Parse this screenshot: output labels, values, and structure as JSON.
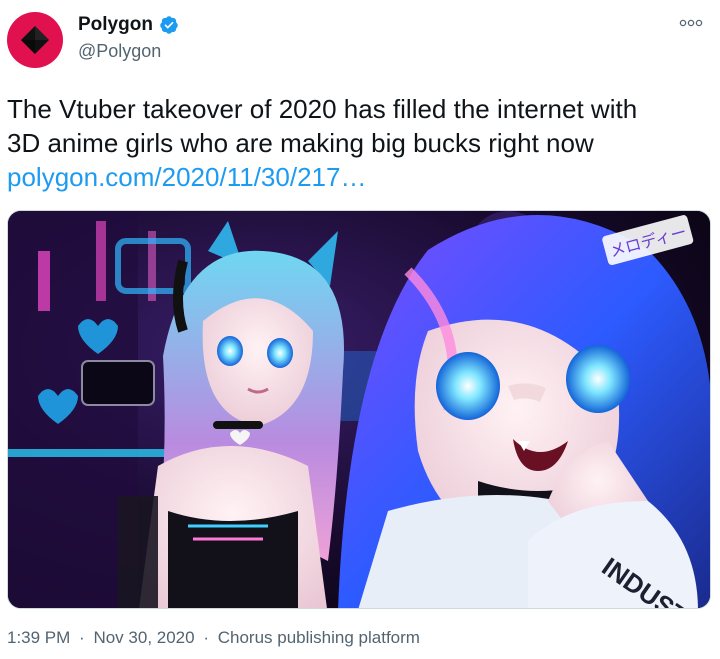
{
  "account": {
    "display_name": "Polygon",
    "handle": "@Polygon",
    "avatar_icon": "polygon-logo",
    "avatar_color": "#e1114f",
    "verified": true,
    "verified_color": "#1d9bf0"
  },
  "more_icon": "more-options-icon",
  "tweet": {
    "text_lines": [
      "The Vtuber takeover of 2020 has filled the internet with",
      "3D anime girls who are making big bucks right now"
    ],
    "link": "polygon.com/2020/11/30/217…"
  },
  "media": {
    "sign_text": "メロディー",
    "glove_text": "INDUSTRIES"
  },
  "meta": {
    "time": "1:39 PM",
    "separator": "·",
    "date": "Nov 30, 2020",
    "source": "Chorus publishing platform"
  },
  "colors": {
    "link": "#1d9bf0",
    "secondary_text": "#536471",
    "primary_text": "#0f1419"
  }
}
